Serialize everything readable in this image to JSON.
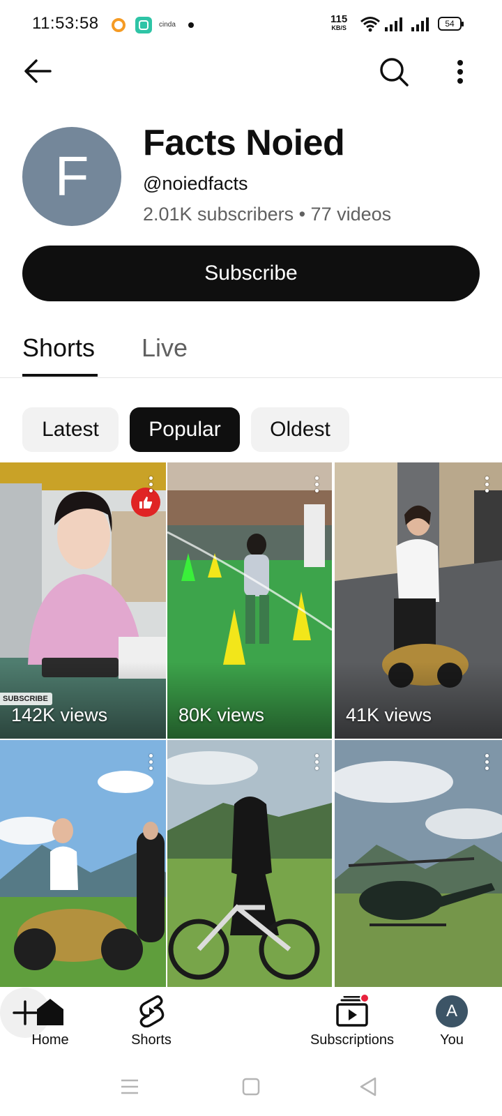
{
  "status_bar": {
    "time": "11:53:58",
    "net_speed_value": "115",
    "net_speed_unit": "KB/S",
    "battery": "54",
    "app3_text": "cinda"
  },
  "header": {
    "back_icon": "arrow-left-icon",
    "search_icon": "search-icon",
    "more_icon": "more-vert-icon"
  },
  "channel": {
    "avatar_letter": "F",
    "avatar_color": "#74879a",
    "name": "Facts Noied",
    "handle": "@noiedfacts",
    "stats": "2.01K subscribers • 77 videos",
    "subscribe_label": "Subscribe"
  },
  "tabs": [
    {
      "label": "Shorts",
      "selected": true
    },
    {
      "label": "Live",
      "selected": false
    }
  ],
  "chips": [
    {
      "label": "Latest",
      "selected": false
    },
    {
      "label": "Popular",
      "selected": true
    },
    {
      "label": "Oldest",
      "selected": false
    }
  ],
  "shorts": [
    {
      "views": "142K views",
      "overlay_badge": "SUBSCRIBE"
    },
    {
      "views": "80K views"
    },
    {
      "views": "41K views"
    },
    {
      "views": ""
    },
    {
      "views": ""
    },
    {
      "views": ""
    }
  ],
  "bottom_nav": {
    "home": "Home",
    "shorts": "Shorts",
    "create_icon": "plus-icon",
    "subscriptions": "Subscriptions",
    "you": "You",
    "you_avatar_letter": "A"
  },
  "colors": {
    "accent": "#0f0f0f",
    "notification_dot": "#e8223d",
    "secondary_text": "#606060"
  }
}
